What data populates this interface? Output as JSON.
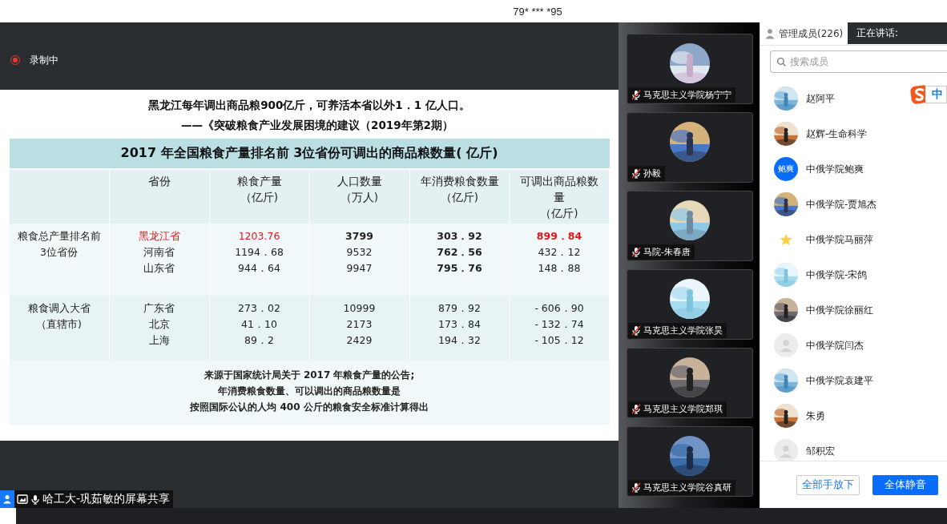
{
  "top_bar": {
    "meeting_id": "79* *** *95"
  },
  "recording": {
    "label": "录制中",
    "on": true
  },
  "slide": {
    "quote": "黑龙江每年调出商品粮900亿斤，可养活本省以外1．1 亿人口。",
    "source": "——《突破粮食产业发展困境的建议（2019年第2期）",
    "table": {
      "title": "2017 年全国粮食产量排名前 3位省份可调出的商品粮数量( 亿斤)",
      "columns": [
        {
          "lines": [
            "省份"
          ]
        },
        {
          "lines": [
            "粮食产量",
            "（亿斤)"
          ]
        },
        {
          "lines": [
            "人口数量",
            "（万人)"
          ]
        },
        {
          "lines": [
            "年消费粮食数量",
            "（亿斤)"
          ]
        },
        {
          "lines": [
            "可调出商品粮数",
            "量",
            "（亿斤)"
          ]
        }
      ],
      "groups": [
        {
          "label": [
            "粮食总产量排名前",
            "3位省份"
          ],
          "rows": [
            [
              {
                "text": "黑龙江省",
                "red": true,
                "bold": false
              },
              {
                "text": "1203.76",
                "red": true,
                "bold": false
              },
              {
                "text": "3799",
                "red": false,
                "bold": true
              },
              {
                "text": "303．92",
                "red": false,
                "bold": true
              },
              {
                "text": "899．84",
                "red": true,
                "bold": true
              }
            ],
            [
              {
                "text": "河南省",
                "red": false,
                "bold": false
              },
              {
                "text": "1194．68",
                "red": false,
                "bold": false
              },
              {
                "text": "9532",
                "red": false,
                "bold": false
              },
              {
                "text": "762．56",
                "red": false,
                "bold": true
              },
              {
                "text": "432．12",
                "red": false,
                "bold": false
              }
            ],
            [
              {
                "text": "山东省",
                "red": false,
                "bold": false
              },
              {
                "text": "944．64",
                "red": false,
                "bold": false
              },
              {
                "text": "9947",
                "red": false,
                "bold": false
              },
              {
                "text": "795．76",
                "red": false,
                "bold": true
              },
              {
                "text": "148．88",
                "red": false,
                "bold": false
              }
            ]
          ]
        },
        {
          "label": [
            "粮食调入大省",
            "（直辖市)"
          ],
          "rows": [
            [
              {
                "text": "广东省",
                "red": false,
                "bold": false
              },
              {
                "text": "273．02",
                "red": false,
                "bold": false
              },
              {
                "text": "10999",
                "red": false,
                "bold": false
              },
              {
                "text": "879．92",
                "red": false,
                "bold": false
              },
              {
                "text": "- 606．90",
                "red": false,
                "bold": false
              }
            ],
            [
              {
                "text": "北京",
                "red": false,
                "bold": false
              },
              {
                "text": "41．10",
                "red": false,
                "bold": false
              },
              {
                "text": "2173",
                "red": false,
                "bold": false
              },
              {
                "text": "173．84",
                "red": false,
                "bold": false
              },
              {
                "text": "- 132．74",
                "red": false,
                "bold": false
              }
            ],
            [
              {
                "text": "上海",
                "red": false,
                "bold": false
              },
              {
                "text": "89．2",
                "red": false,
                "bold": false
              },
              {
                "text": "2429",
                "red": false,
                "bold": false
              },
              {
                "text": "194．32",
                "red": false,
                "bold": false
              },
              {
                "text": "- 105．12",
                "red": false,
                "bold": false
              }
            ]
          ]
        }
      ],
      "note": [
        "来源于国家统计局关于 2017 年粮食产量的公告;",
        "年消费粮食数量、可以调出的商品粮数量是",
        "按照国际公认的人均 400 公斤的粮食安全标准计算得出"
      ]
    }
  },
  "share_label": "哈工大-巩茹敏的屏幕共享",
  "video_tiles": [
    {
      "name": "马克思主义学院杨宁宁",
      "muted": true
    },
    {
      "name": "孙毅",
      "muted": true
    },
    {
      "name": "马院-朱春唐",
      "muted": true
    },
    {
      "name": "马克思主义学院张昊",
      "muted": true
    },
    {
      "name": "马克思主义学院郑琪",
      "muted": true
    },
    {
      "name": "马克思主义学院谷真研",
      "muted": true
    }
  ],
  "members_panel": {
    "tab": "管理成员(226)",
    "speaking": "正在讲话:",
    "search": {
      "placeholder": "搜索成员"
    },
    "ime_badge": "中",
    "members": [
      {
        "name": "赵阿平"
      },
      {
        "name": "赵辉-生命科学"
      },
      {
        "name": "中俄学院鲍爽",
        "avatar": {
          "kind": "text",
          "text": "鲍爽"
        }
      },
      {
        "name": "中俄学院-贾旭杰"
      },
      {
        "name": "中俄学院马丽萍",
        "avatar": {
          "kind": "star"
        }
      },
      {
        "name": "中俄学院-宋鸽"
      },
      {
        "name": "中俄学院徐丽红"
      },
      {
        "name": "中俄学院闫杰",
        "avatar": {
          "kind": "default"
        }
      },
      {
        "name": "中俄学院袁建平"
      },
      {
        "name": "朱勇"
      },
      {
        "name": "邹积宏",
        "avatar": {
          "kind": "default"
        }
      }
    ],
    "buttons": [
      {
        "label": "全部手放下",
        "kind": "secondary"
      },
      {
        "label": "全体静音",
        "kind": "primary"
      }
    ]
  }
}
